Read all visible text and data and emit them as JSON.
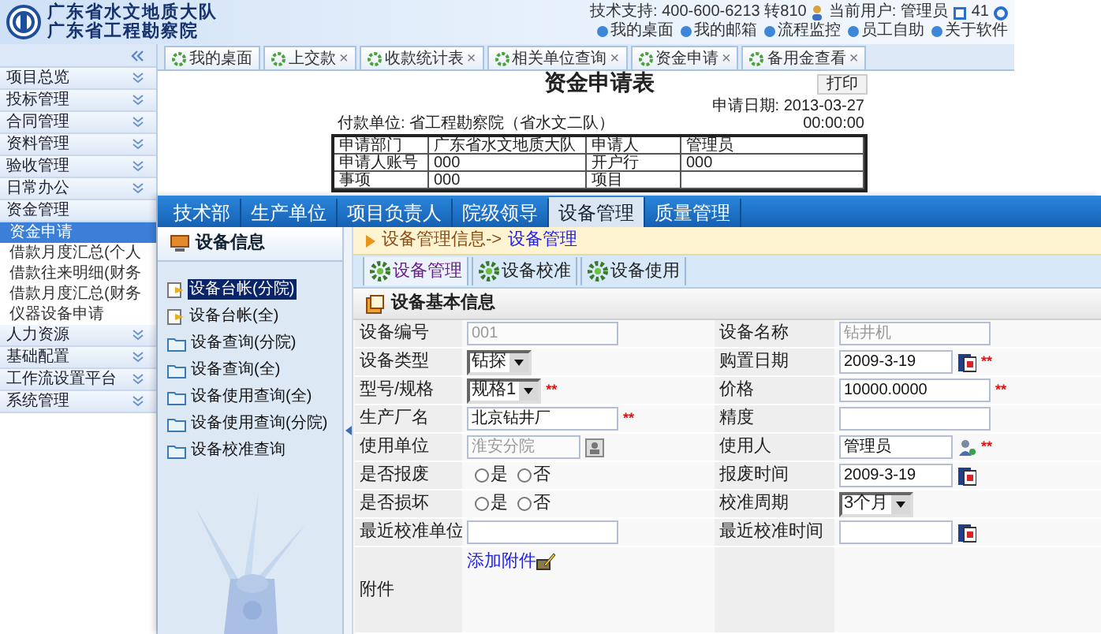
{
  "header": {
    "org_lines": [
      "广东省水文地质大队",
      "广东省工程勘察院"
    ],
    "support": "技术支持: 400-600-6213 转810",
    "user": "当前用户: 管理员",
    "count": "41",
    "links": [
      {
        "label": "我的桌面"
      },
      {
        "label": "我的邮箱"
      },
      {
        "label": "流程监控"
      },
      {
        "label": "员工自助"
      },
      {
        "label": "关于软件"
      }
    ]
  },
  "sidebar": {
    "items": [
      {
        "label": "项目总览",
        "expanded": false
      },
      {
        "label": "投标管理",
        "expanded": false
      },
      {
        "label": "合同管理",
        "expanded": false
      },
      {
        "label": "资料管理",
        "expanded": false
      },
      {
        "label": "验收管理",
        "expanded": false
      },
      {
        "label": "日常办公",
        "expanded": false
      },
      {
        "label": "资金管理",
        "expanded": true,
        "children": [
          {
            "label": "资金申请",
            "selected": true
          },
          {
            "label": "借款月度汇总(个人",
            "selected": false
          },
          {
            "label": "借款往来明细(财务",
            "selected": false
          },
          {
            "label": "借款月度汇总(财务",
            "selected": false
          },
          {
            "label": "仪器设备申请",
            "selected": false
          }
        ]
      },
      {
        "label": "人力资源",
        "expanded": false
      },
      {
        "label": "基础配置",
        "expanded": false
      },
      {
        "label": "工作流设置平台",
        "expanded": false
      },
      {
        "label": "系统管理",
        "expanded": false
      }
    ]
  },
  "tabs": [
    {
      "label": "我的桌面"
    },
    {
      "label": "上交款",
      "close": "×"
    },
    {
      "label": "收款统计表",
      "close": "×"
    },
    {
      "label": "相关单位查询",
      "close": "×"
    },
    {
      "label": "资金申请",
      "close": "×"
    },
    {
      "label": "备用金查看",
      "close": "×"
    }
  ],
  "document": {
    "title": "资金申请表",
    "print_button": "打印",
    "payer": "付款单位: 省工程勘察院（省水文二队）",
    "date": "申请日期: 2013-03-27",
    "time": "00:00:00",
    "rows": [
      [
        "申请部门",
        "广东省水文地质大队",
        "申请人",
        "管理员"
      ],
      [
        "申请人账号",
        "000",
        "开户行",
        "000"
      ],
      [
        "事项",
        "000",
        "项目"
      ]
    ]
  },
  "window": {
    "tabs": [
      {
        "label": "技术部",
        "selected": false
      },
      {
        "label": "生产单位",
        "selected": false
      },
      {
        "label": "项目负责人",
        "selected": false
      },
      {
        "label": "院级领导",
        "selected": false
      },
      {
        "label": "设备管理",
        "selected": true
      },
      {
        "label": "质量管理",
        "selected": false
      }
    ],
    "tree": {
      "title": "设备信息",
      "items": [
        {
          "label": "设备台帐(分院)",
          "kind": "document",
          "selected": true
        },
        {
          "label": "设备台帐(全)",
          "kind": "document",
          "selected": false
        },
        {
          "label": "设备查询(分院)",
          "kind": "folder",
          "selected": false
        },
        {
          "label": "设备查询(全)",
          "kind": "folder",
          "selected": false
        },
        {
          "label": "设备使用查询(全)",
          "kind": "folder",
          "selected": false
        },
        {
          "label": "设备使用查询(分院)",
          "kind": "folder",
          "selected": false
        },
        {
          "label": "设备校准查询",
          "kind": "folder",
          "selected": false
        }
      ]
    },
    "breadcrumb": {
      "path": "设备管理信息->",
      "current": "设备管理"
    },
    "toolbar": [
      {
        "label": "设备管理",
        "selected": true
      },
      {
        "label": "设备校准",
        "selected": false
      },
      {
        "label": "设备使用",
        "selected": false
      }
    ],
    "section": "设备基本信息",
    "rows": [
      [
        {
          "label": "设备编号",
          "kind": "text",
          "value": "001",
          "disabled": true
        },
        {
          "label": "设备名称",
          "kind": "text",
          "value": "钻井机",
          "disabled": true
        }
      ],
      [
        {
          "label": "设备类型",
          "kind": "select",
          "value": "钻探"
        },
        {
          "label": "购置日期",
          "kind": "date",
          "value": "2009-3-19",
          "mark": "**"
        }
      ],
      [
        {
          "label": "型号/规格",
          "kind": "select",
          "value": "规格1",
          "mark": "**"
        },
        {
          "label": "价格",
          "kind": "text",
          "value": "10000.0000",
          "disabled": false,
          "mark": "**"
        }
      ],
      [
        {
          "label": "生产厂名",
          "kind": "text",
          "value": "北京钻井厂",
          "disabled": false,
          "mark": "**"
        },
        {
          "label": "精度",
          "kind": "text"
        }
      ],
      [
        {
          "label": "使用单位",
          "kind": "picker",
          "value": "淮安分院",
          "disabled": true
        },
        {
          "label": "使用人",
          "kind": "user",
          "value": "管理员",
          "mark": "**"
        }
      ],
      [
        {
          "label": "是否报废",
          "kind": "radio",
          "options": [
            {
              "label": "是",
              "selected": false
            },
            {
              "label": "否",
              "selected": false
            }
          ]
        },
        {
          "label": "报废时间",
          "kind": "date",
          "value": "2009-3-19"
        }
      ],
      [
        {
          "label": "是否损坏",
          "kind": "radio",
          "options": [
            {
              "label": "是",
              "selected": false
            },
            {
              "label": "否",
              "selected": false
            }
          ]
        },
        {
          "label": "校准周期",
          "kind": "select",
          "value": "3个月"
        }
      ],
      [
        {
          "label": "最近校准单位",
          "kind": "text"
        },
        {
          "label": "最近校准时间",
          "kind": "date"
        }
      ],
      [
        {
          "label": "附件",
          "kind": "attachment",
          "link": "添加附件"
        }
      ]
    ]
  }
}
